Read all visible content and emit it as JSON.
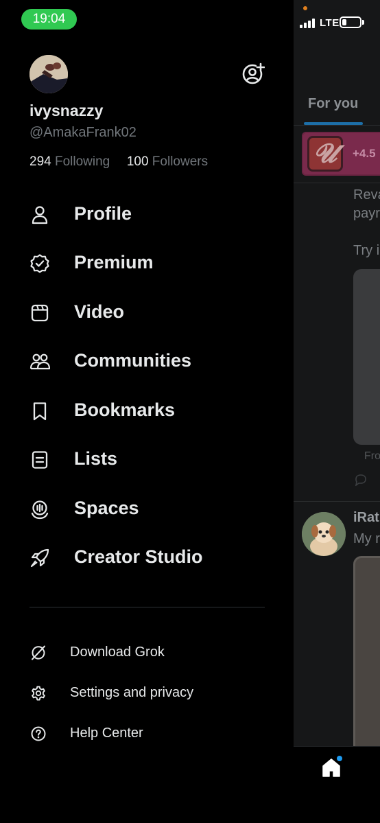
{
  "status_bar": {
    "time": "19:04",
    "network": "LTE"
  },
  "drawer": {
    "username": "ivysnazzy",
    "handle": "@AmakaFrank02",
    "following_count": "294",
    "following_label": "Following",
    "followers_count": "100",
    "followers_label": "Followers",
    "menu": [
      {
        "label": "Profile",
        "icon": "person-icon"
      },
      {
        "label": "Premium",
        "icon": "verified-badge-icon"
      },
      {
        "label": "Video",
        "icon": "video-icon"
      },
      {
        "label": "Communities",
        "icon": "communities-icon"
      },
      {
        "label": "Bookmarks",
        "icon": "bookmark-icon"
      },
      {
        "label": "Lists",
        "icon": "list-icon"
      },
      {
        "label": "Spaces",
        "icon": "spaces-icon"
      },
      {
        "label": "Creator Studio",
        "icon": "rocket-icon"
      }
    ],
    "secondary": [
      {
        "label": "Download Grok",
        "icon": "grok-icon"
      },
      {
        "label": "Settings and privacy",
        "icon": "gear-icon"
      },
      {
        "label": "Help Center",
        "icon": "help-icon"
      }
    ]
  },
  "feed": {
    "tab_label": "For you",
    "promo_value": "+4.5",
    "post1_line1": "Reva",
    "post1_line2": "payr",
    "post1_line3": "Try i",
    "from_label": "Fro",
    "post2_name": "iRat",
    "post2_text": "My r"
  },
  "colors": {
    "accent": "#1d9bf0",
    "status_pill": "#30c952",
    "muted_text": "#71767b"
  }
}
